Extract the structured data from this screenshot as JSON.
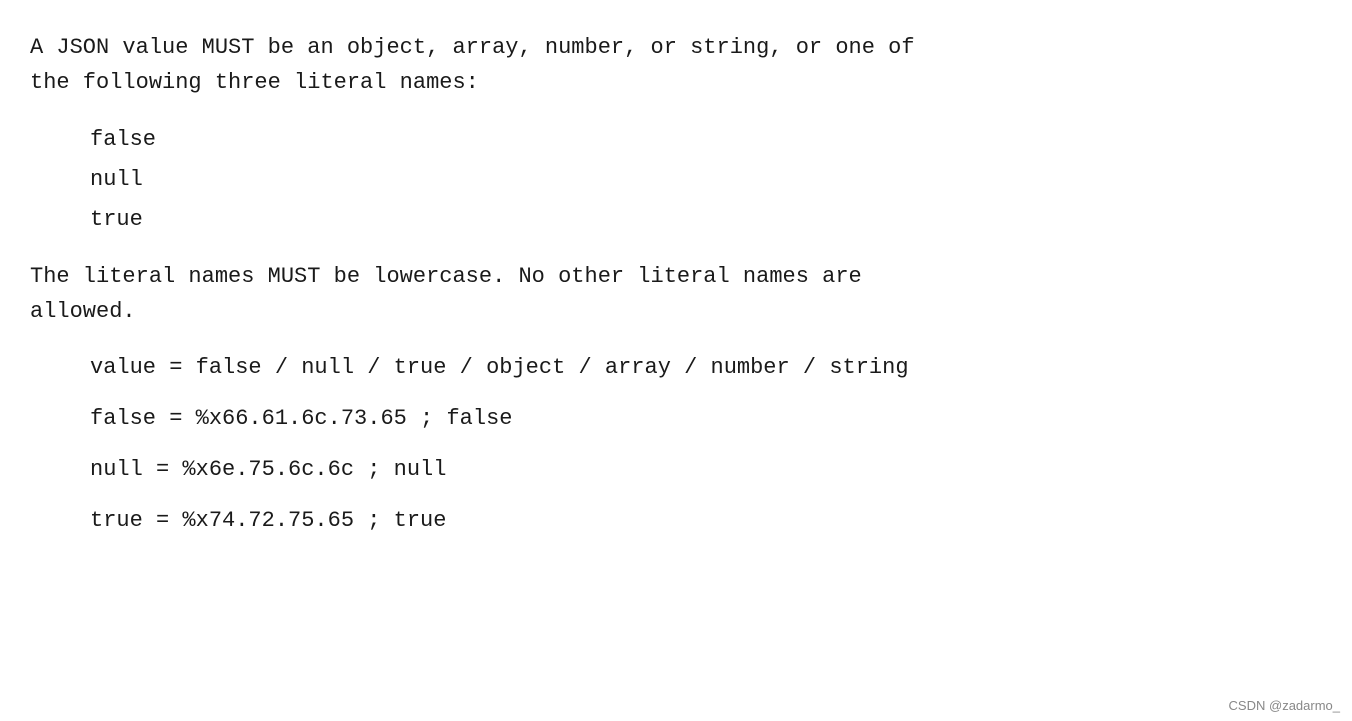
{
  "content": {
    "paragraph1": "A JSON value MUST be an object, array, number, or string, or one of\nthe following three literal names:",
    "literal_values": [
      "false",
      "null",
      "true"
    ],
    "paragraph2": "The literal names MUST be lowercase.  No other literal names are\nallowed.",
    "grammar_lines": [
      "value = false / null / true / object / array / number / string",
      "false = %x66.61.6c.73.65    ; false",
      "null  = %x6e.75.6c.6c       ; null",
      "true  = %x74.72.75.65       ; true"
    ],
    "watermark": "CSDN @zadarmo_"
  }
}
